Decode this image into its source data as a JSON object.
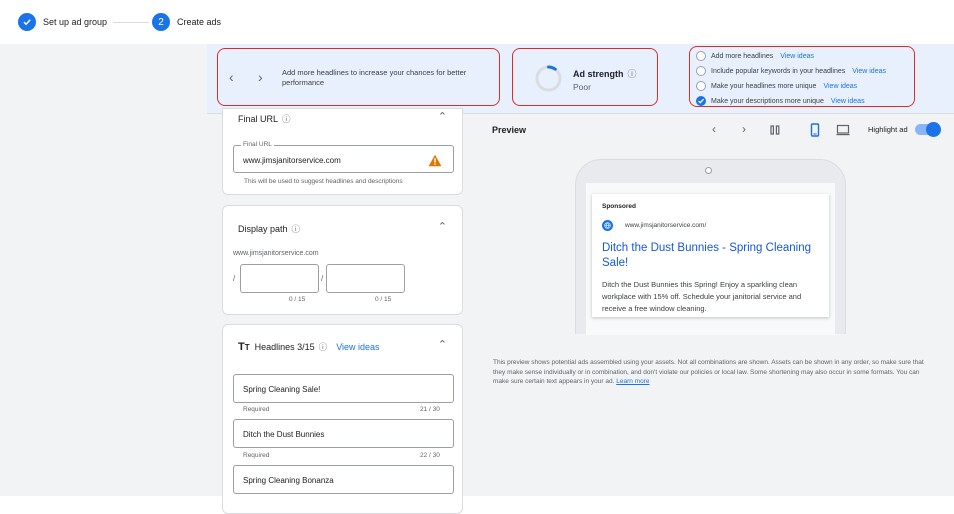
{
  "stepper": {
    "step1": {
      "label": "Set up ad group"
    },
    "step2": {
      "number": "2",
      "label": "Create ads"
    }
  },
  "tips": {
    "message": "Add more headlines to increase your chances for better performance"
  },
  "ad_strength": {
    "title": "Ad strength",
    "value": "Poor",
    "level": 0.1
  },
  "checklist": [
    {
      "label": "Add more headlines",
      "link": "View ideas",
      "done": false
    },
    {
      "label": "Include popular keywords in your headlines",
      "link": "View ideas",
      "done": false
    },
    {
      "label": "Make your headlines more unique",
      "link": "View ideas",
      "done": false
    },
    {
      "label": "Make your descriptions more unique",
      "link": "View ideas",
      "done": true
    }
  ],
  "final_url": {
    "title": "Final URL",
    "field_label": "Final URL",
    "value": "www.jimsjanitorservice.com",
    "hint": "This will be used to suggest headlines and descriptions"
  },
  "display_path": {
    "title": "Display path",
    "base": "www.jimsjanitorservice.com",
    "sep1": "/",
    "sep2": "/",
    "counter1": "0 / 15",
    "counter2": "0 / 15"
  },
  "headlines": {
    "title": "Headlines 3/15",
    "view_ideas": "View ideas",
    "items": [
      {
        "value": "Spring Cleaning Sale!",
        "hint": "Required",
        "counter": "21 / 30"
      },
      {
        "value": "Ditch the Dust Bunnies",
        "hint": "Required",
        "counter": "22 / 30"
      },
      {
        "value": "Spring Cleaning Bonanza"
      }
    ]
  },
  "preview": {
    "title": "Preview",
    "highlight_label": "Highlight ad",
    "highlight_on": true,
    "ad": {
      "sponsored": "Sponsored",
      "url": "www.jimsjanitorservice.com/",
      "headline": "Ditch the Dust Bunnies - Spring Cleaning Sale!",
      "description": "Ditch the Dust Bunnies this Spring! Enjoy a sparkling clean workplace with 15% off. Schedule your janitorial service and receive a free window cleaning."
    },
    "disclaimer": "This preview shows potential ads assembled using your assets. Not all combinations are shown. Assets can be shown in any order, so make sure that they make sense individually or in combination, and don't violate our policies or local law. Some shortening may also occur in some formats. You can make sure certain text appears in your ad.",
    "learn_more": "Learn more"
  },
  "colors": {
    "accent": "#1a73e8",
    "highlight_border": "#d93025",
    "warning": "#e37400"
  },
  "icons": [
    "check-icon",
    "help-icon",
    "chevron-left-icon",
    "chevron-right-icon",
    "chevron-up-icon",
    "warning-icon",
    "text-icon",
    "pause-icon",
    "mobile-icon",
    "desktop-icon",
    "globe-icon"
  ]
}
